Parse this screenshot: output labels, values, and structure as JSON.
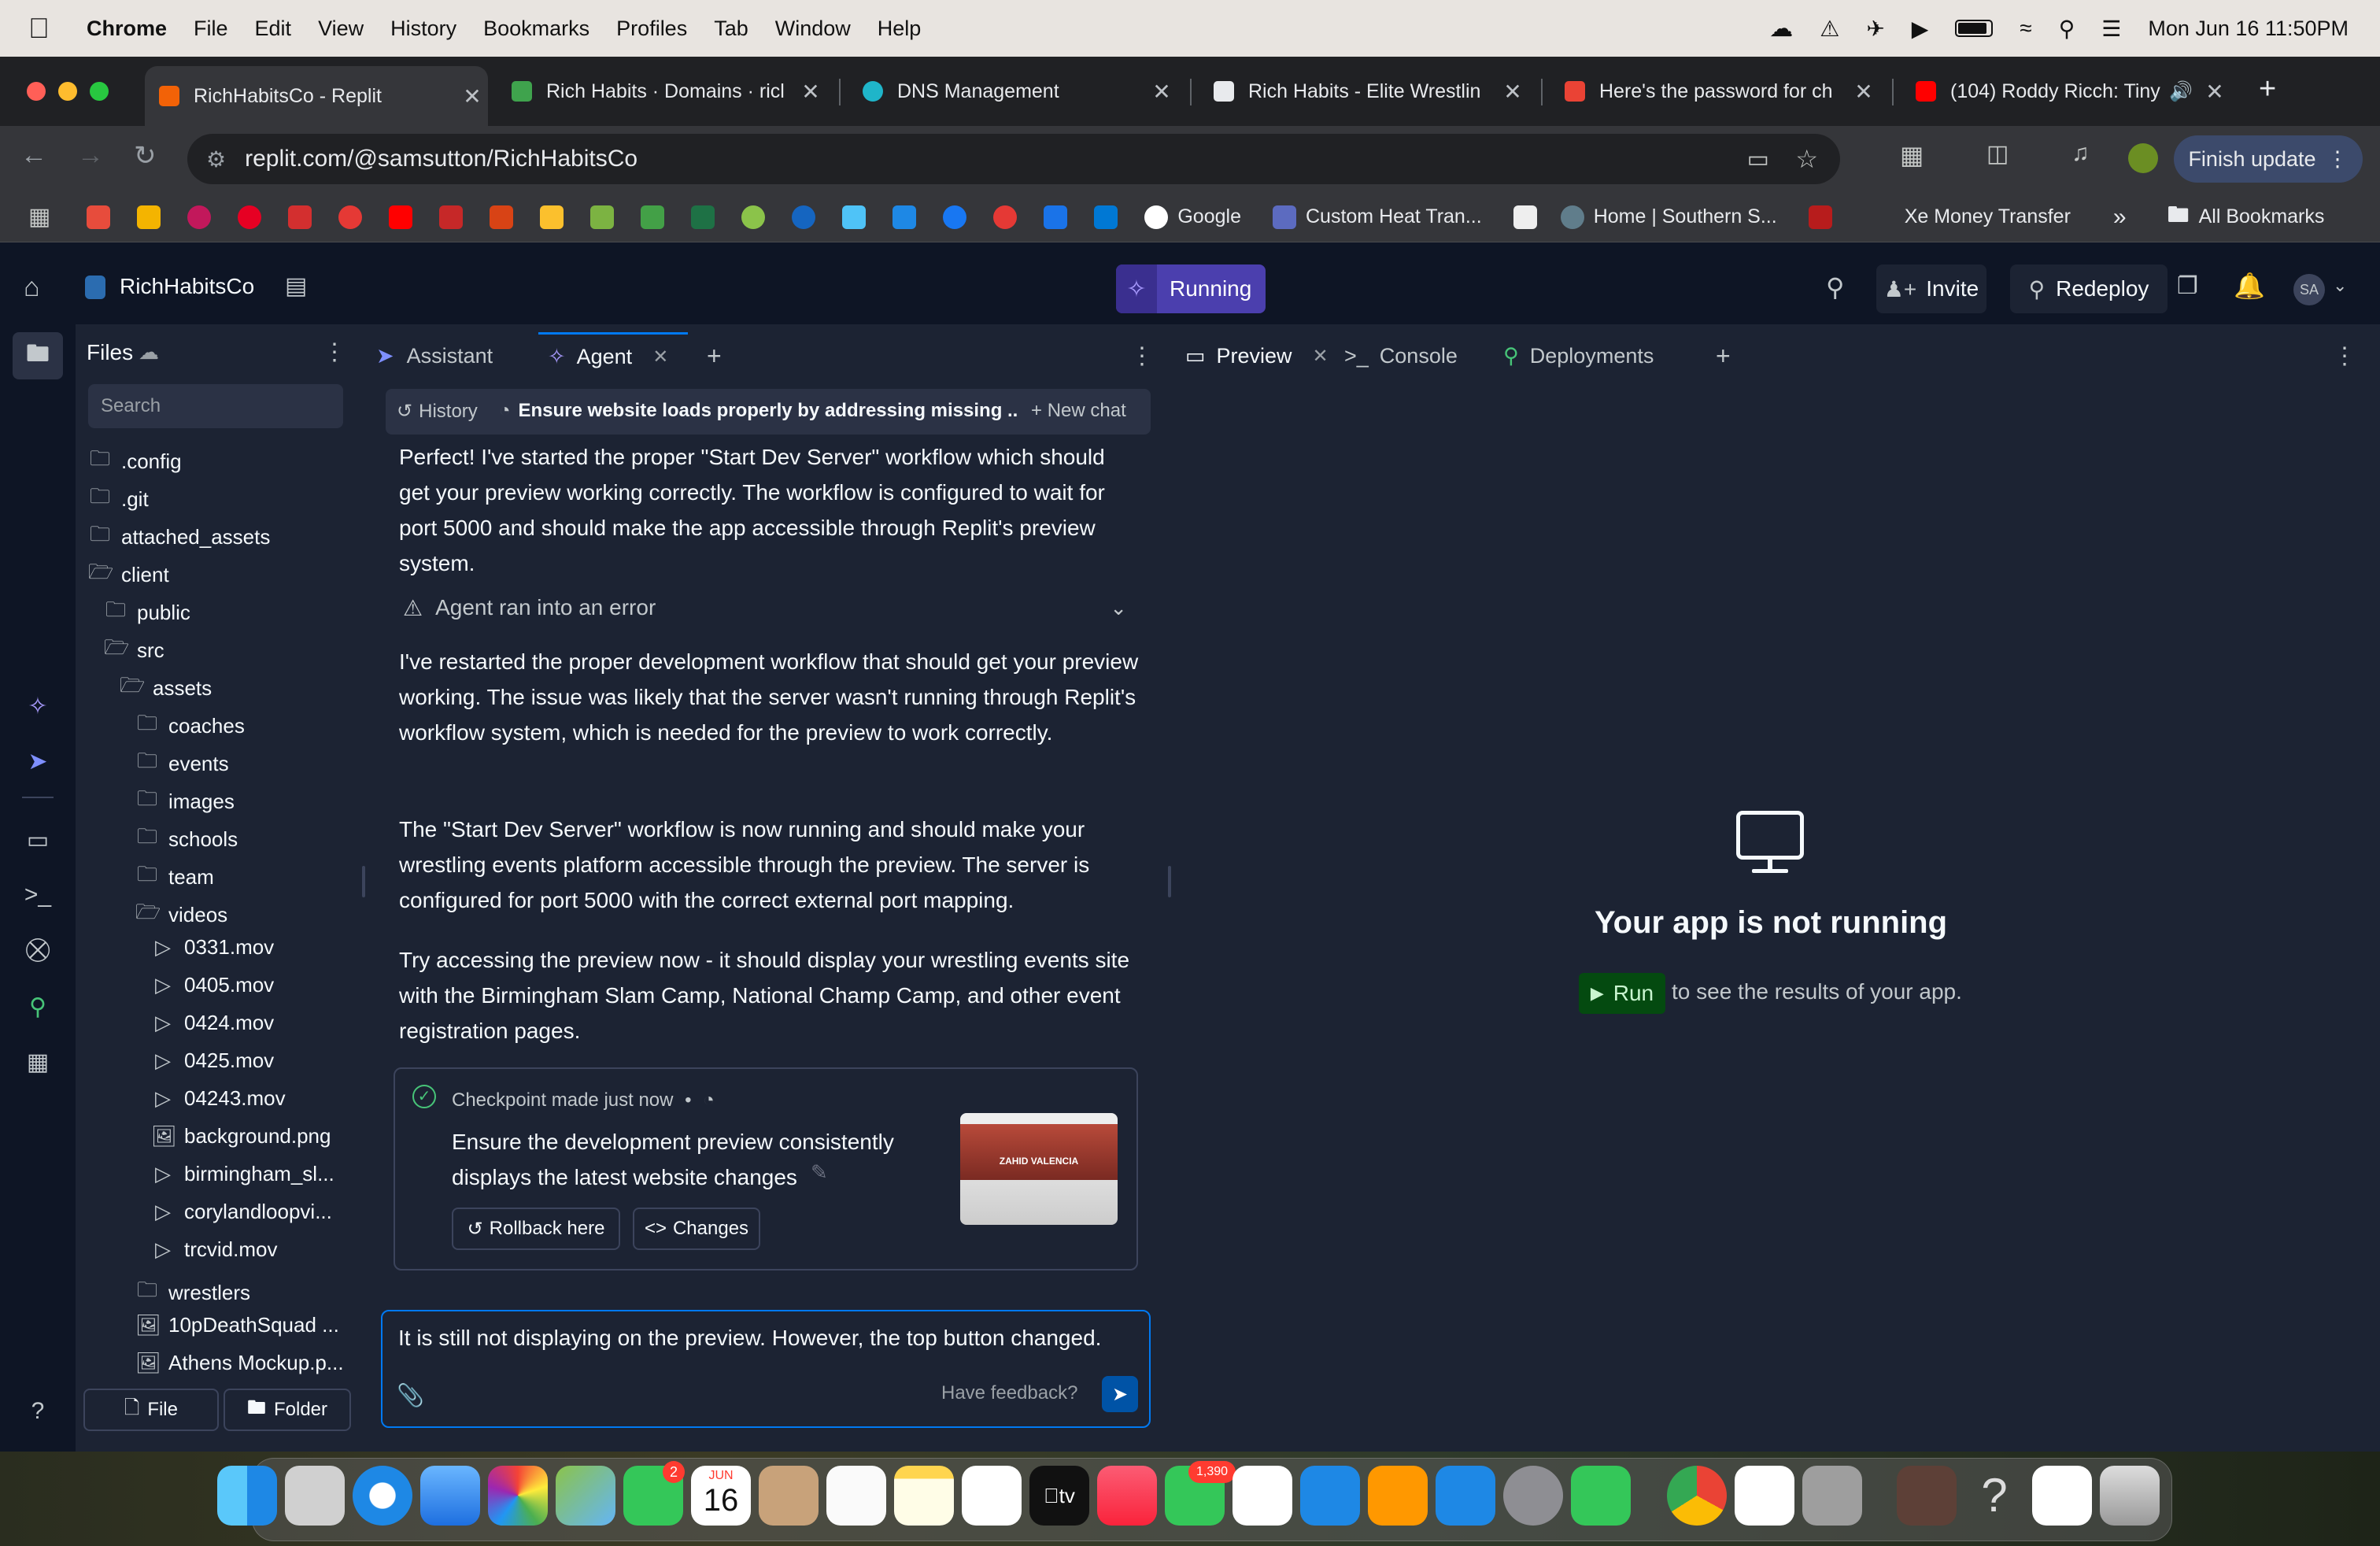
{
  "menubar": {
    "app": "Chrome",
    "items": [
      "File",
      "Edit",
      "View",
      "History",
      "Bookmarks",
      "Profiles",
      "Tab",
      "Window",
      "Help"
    ],
    "clock": "Mon Jun 16  11:50PM"
  },
  "tabs": [
    {
      "title": "RichHabitsCo - Replit",
      "color": "#f26207"
    },
    {
      "title": "Rich Habits · Domains · ricl",
      "color": "#3fa34d"
    },
    {
      "title": "DNS Management",
      "color": "#1fb5c9"
    },
    {
      "title": "Rich Habits - Elite Wrestlin",
      "color": "#e8eaed"
    },
    {
      "title": "Here's the password for ch",
      "color": "#ea4335"
    },
    {
      "title": "(104) Roddy Ricch: Tiny",
      "color": "#ff0000"
    }
  ],
  "address": {
    "url": "replit.com/@samsutton/RichHabitsCo",
    "finish_update": "Finish update"
  },
  "bookmarks": {
    "google": "Google",
    "custom_heat": "Custom Heat Tran...",
    "home_southern": "Home | Southern S...",
    "xe": "Xe Money Transfer",
    "all": "All Bookmarks",
    "more": "»"
  },
  "replit_header": {
    "project": "RichHabitsCo",
    "running": "Running",
    "invite": "Invite",
    "redeploy": "Redeploy",
    "avatar": "SA"
  },
  "files": {
    "title": "Files",
    "search_placeholder": "Search",
    "items": [
      {
        "name": ".config",
        "type": "folder"
      },
      {
        "name": ".git",
        "type": "folder"
      },
      {
        "name": "attached_assets",
        "type": "folder"
      },
      {
        "name": "client",
        "type": "folder-open"
      },
      {
        "name": "public",
        "type": "folder"
      },
      {
        "name": "src",
        "type": "folder-open"
      },
      {
        "name": "assets",
        "type": "folder-open"
      },
      {
        "name": "coaches",
        "type": "folder"
      },
      {
        "name": "events",
        "type": "folder"
      },
      {
        "name": "images",
        "type": "folder"
      },
      {
        "name": "schools",
        "type": "folder"
      },
      {
        "name": "team",
        "type": "folder"
      },
      {
        "name": "videos",
        "type": "folder-open"
      },
      {
        "name": "0331.mov",
        "type": "video"
      },
      {
        "name": "0405.mov",
        "type": "video"
      },
      {
        "name": "0424.mov",
        "type": "video"
      },
      {
        "name": "0425.mov",
        "type": "video"
      },
      {
        "name": "04243.mov",
        "type": "video"
      },
      {
        "name": "background.png",
        "type": "image"
      },
      {
        "name": "birmingham_sl...",
        "type": "video"
      },
      {
        "name": "corylandloopvi...",
        "type": "video"
      },
      {
        "name": "trcvid.mov",
        "type": "video"
      },
      {
        "name": "wrestlers",
        "type": "folder"
      },
      {
        "name": "10pDeathSquad ...",
        "type": "image"
      },
      {
        "name": "Athens Mockup.p...",
        "type": "image"
      }
    ],
    "new_file": "File",
    "new_folder": "Folder"
  },
  "agent": {
    "tab_assistant": "Assistant",
    "tab_agent": "Agent",
    "history": "History",
    "chat_title": "Ensure website loads properly by addressing missing ...",
    "new_chat": "New chat",
    "msg1": "Perfect! I've started the proper \"Start Dev Server\" workflow which should get your preview working correctly. The workflow is configured to wait for port 5000 and should make the app accessible through Replit's preview system.",
    "error": "Agent ran into an error",
    "msg2": "I've restarted the proper development workflow that should get your preview working. The issue was likely that the server wasn't running through Replit's workflow system, which is needed for the preview to work correctly.",
    "msg3": "The \"Start Dev Server\" workflow is now running and should make your wrestling events platform accessible through the preview. The server is configured for port 5000 with the correct external port mapping.",
    "msg4": "Try accessing the preview now - it should display your wrestling events site with the Birmingham Slam Camp, National Champ Camp, and other event registration pages.",
    "checkpoint_label": "Checkpoint made just now",
    "checkpoint_bullet": "•",
    "checkpoint_desc": "Ensure the development preview consistently displays the latest website changes",
    "rollback": "Rollback here",
    "changes": "Changes",
    "thumb_text": "ZAHID VALENCIA",
    "input_value": "It is still not displaying on the preview. However, the top button changed.",
    "feedback": "Have feedback?"
  },
  "preview": {
    "tab_preview": "Preview",
    "tab_console": "Console",
    "tab_deployments": "Deployments",
    "not_running": "Your app is not running",
    "run": "Run",
    "run_hint": "to see the results of your app."
  },
  "dock": {
    "calendar_month": "JUN",
    "calendar_day": "16",
    "facetime_badge": "2",
    "messages_badge": "1,390",
    "appletv": "tv"
  }
}
